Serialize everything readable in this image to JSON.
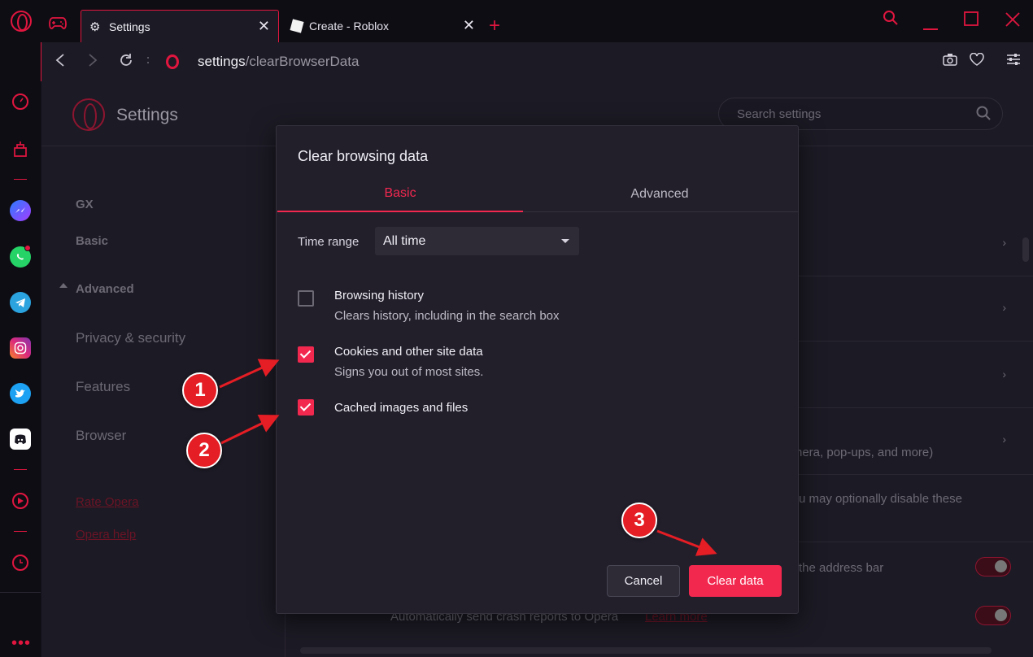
{
  "browser": {
    "tabs": [
      {
        "label": "Settings",
        "icon": "gear-icon",
        "active": true
      },
      {
        "label": "Create - Roblox",
        "icon": "roblox-icon",
        "active": false
      }
    ],
    "url_host": "settings",
    "url_path": "/clearBrowserData",
    "accent_color": "#e0163f"
  },
  "settings": {
    "title": "Settings",
    "search_placeholder": "Search settings",
    "nav": {
      "gx": "GX",
      "basic": "Basic",
      "advanced": "Advanced",
      "privacy": "Privacy & security",
      "features": "Features",
      "browser": "Browser",
      "rate": "Rate Opera",
      "help": "Opera help"
    },
    "bg_texts": {
      "row4_fragment": "nera, pop-ups, and more)",
      "row5_fragment": "u may optionally disable these",
      "row6_fragment": "the address bar",
      "row7_text": "Automatically send crash reports to Opera",
      "row7_link": "Learn more"
    }
  },
  "dialog": {
    "title": "Clear browsing data",
    "tabs": {
      "basic": "Basic",
      "advanced": "Advanced"
    },
    "time_range_label": "Time range",
    "time_range_value": "All time",
    "options": [
      {
        "title": "Browsing history",
        "subtitle": "Clears history, including in the search box",
        "checked": false
      },
      {
        "title": "Cookies and other site data",
        "subtitle": "Signs you out of most sites.",
        "checked": true
      },
      {
        "title": "Cached images and files",
        "subtitle": "",
        "checked": true
      }
    ],
    "cancel_label": "Cancel",
    "clear_label": "Clear data",
    "primary_color": "#f2284f"
  },
  "annotations": {
    "badges": [
      "1",
      "2",
      "3"
    ],
    "color": "#e51d24"
  }
}
